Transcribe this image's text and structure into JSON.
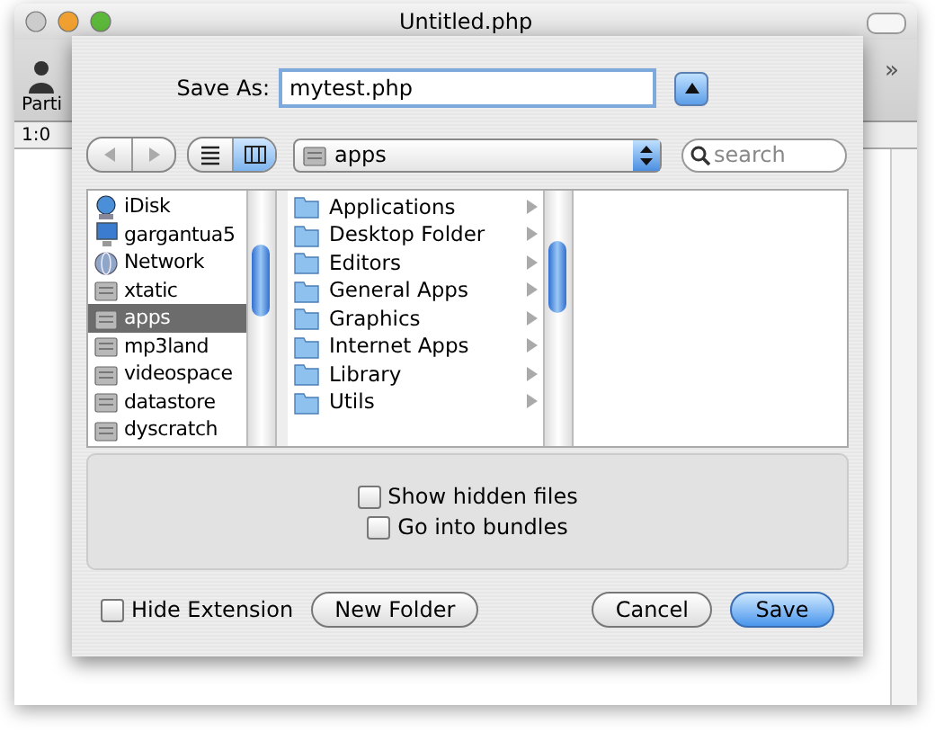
{
  "window": {
    "title": "Untitled.php",
    "toolbar_label": "Parti",
    "status": "1:0",
    "overflow": "»"
  },
  "dialog": {
    "save_as_label": "Save As:",
    "filename": "mytest.php",
    "expanded": true,
    "location": "apps",
    "search": {
      "placeholder": "search"
    },
    "history": [
      {
        "kind": "back",
        "disabled": true
      },
      {
        "kind": "forward",
        "disabled": true
      }
    ],
    "view_modes": [
      {
        "kind": "list",
        "selected": false
      },
      {
        "kind": "columns",
        "selected": true
      }
    ],
    "sidebar": [
      {
        "label": "iDisk",
        "kind": "idisk",
        "selected": false
      },
      {
        "label": "gargantua5",
        "kind": "computer",
        "selected": false
      },
      {
        "label": "Network",
        "kind": "network",
        "selected": false
      },
      {
        "label": "xtatic",
        "kind": "drive",
        "selected": false
      },
      {
        "label": "apps",
        "kind": "drive",
        "selected": true
      },
      {
        "label": "mp3land",
        "kind": "drive",
        "selected": false
      },
      {
        "label": "videospace",
        "kind": "drive",
        "selected": false
      },
      {
        "label": "datastore",
        "kind": "drive",
        "selected": false
      },
      {
        "label": "dyscratch",
        "kind": "drive",
        "selected": false
      }
    ],
    "folders": [
      {
        "label": "Applications",
        "selected": false
      },
      {
        "label": "Desktop Folder",
        "selected": false
      },
      {
        "label": "Editors",
        "selected": false
      },
      {
        "label": "General Apps",
        "selected": false
      },
      {
        "label": "Graphics",
        "selected": false
      },
      {
        "label": "Internet Apps",
        "selected": false
      },
      {
        "label": "Library",
        "selected": false
      },
      {
        "label": "Utils",
        "selected": false
      }
    ],
    "options": [
      {
        "label": "Show hidden files",
        "checked": false
      },
      {
        "label": "Go into bundles",
        "checked": false
      }
    ],
    "hide_extension": {
      "label": "Hide Extension",
      "checked": false
    },
    "buttons": [
      {
        "label": "New Folder",
        "kind": "secondary"
      },
      {
        "label": "Cancel",
        "kind": "secondary"
      },
      {
        "label": "Save",
        "kind": "default"
      }
    ]
  }
}
